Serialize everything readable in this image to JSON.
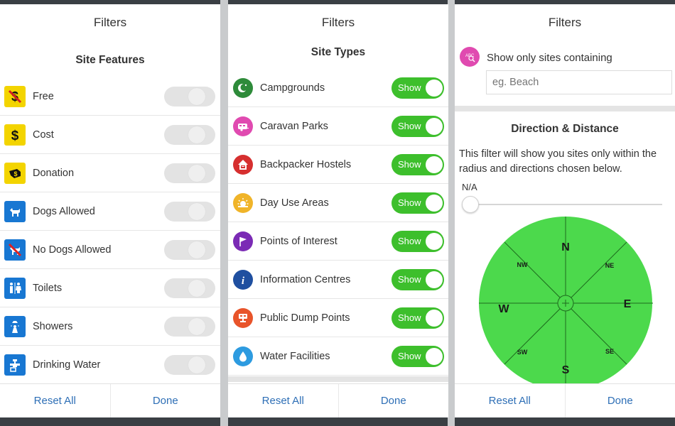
{
  "panels": [
    {
      "title": "Filters",
      "section": "Site Features",
      "rows": [
        {
          "label": "Free",
          "icon": "free-dollar-icon"
        },
        {
          "label": "Cost",
          "icon": "dollar-icon"
        },
        {
          "label": "Donation",
          "icon": "donation-icon"
        },
        {
          "label": "Dogs Allowed",
          "icon": "dog-icon"
        },
        {
          "label": "No Dogs Allowed",
          "icon": "no-dog-icon"
        },
        {
          "label": "Toilets",
          "icon": "toilets-icon"
        },
        {
          "label": "Showers",
          "icon": "shower-icon"
        },
        {
          "label": "Drinking Water",
          "icon": "water-tap-icon"
        }
      ],
      "footer": {
        "reset": "Reset All",
        "done": "Done"
      }
    },
    {
      "title": "Filters",
      "section": "Site Types",
      "toggle_label": "Show",
      "rows": [
        {
          "label": "Campgrounds",
          "icon": "campground-icon",
          "color": "#2e8b3a"
        },
        {
          "label": "Caravan Parks",
          "icon": "caravan-icon",
          "color": "#e04ab0"
        },
        {
          "label": "Backpacker Hostels",
          "icon": "hostel-icon",
          "color": "#d62f2f"
        },
        {
          "label": "Day Use Areas",
          "icon": "sun-icon",
          "color": "#f0b429"
        },
        {
          "label": "Points of Interest",
          "icon": "flag-icon",
          "color": "#7b2bb5"
        },
        {
          "label": "Information Centres",
          "icon": "info-icon",
          "color": "#1f4fa0"
        },
        {
          "label": "Public Dump Points",
          "icon": "dump-point-icon",
          "color": "#e8542a"
        },
        {
          "label": "Water Facilities",
          "icon": "water-drop-icon",
          "color": "#2d9be0"
        }
      ],
      "footer": {
        "reset": "Reset All",
        "done": "Done"
      }
    },
    {
      "title": "Filters",
      "search": {
        "label": "Show only sites containing",
        "placeholder": "eg. Beach"
      },
      "section": "Direction & Distance",
      "description": "This filter will show you sites only within the radius and directions chosen below.",
      "slider": {
        "value_label": "N/A",
        "value": 0
      },
      "compass": {
        "n": "N",
        "s": "S",
        "e": "E",
        "w": "W",
        "ne": "NE",
        "nw": "NW",
        "se": "SE",
        "sw": "SW"
      },
      "footer": {
        "reset": "Reset All",
        "done": "Done"
      }
    }
  ],
  "colors": {
    "toggle_on": "#3dbf2c",
    "link_blue": "#2e6fb6",
    "compass_fill": "#4cd94c",
    "feature_icon_blue": "#1877d2",
    "feature_icon_yellow": "#f3d400"
  }
}
